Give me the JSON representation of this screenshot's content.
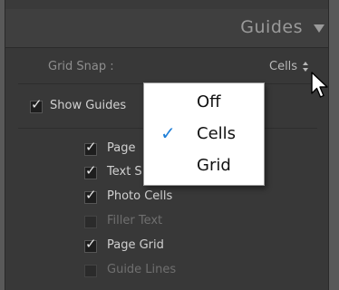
{
  "panel": {
    "title": "Guides"
  },
  "grid_snap": {
    "label": "Grid Snap :",
    "value": "Cells"
  },
  "show_guides": {
    "label": "Show Guides",
    "checked": true
  },
  "guide_items": [
    {
      "label": "Page",
      "checked": true
    },
    {
      "label": "Text S",
      "checked": true
    },
    {
      "label": "Photo Cells",
      "checked": true
    },
    {
      "label": "Filler Text",
      "checked": false
    },
    {
      "label": "Page Grid",
      "checked": true
    },
    {
      "label": "Guide Lines",
      "checked": false
    }
  ],
  "dropdown": {
    "options": [
      {
        "label": "Off",
        "selected": false
      },
      {
        "label": "Cells",
        "selected": true
      },
      {
        "label": "Grid",
        "selected": false
      }
    ]
  },
  "colors": {
    "panel_bg": "#383838",
    "check_accent": "#1f7fd8"
  }
}
